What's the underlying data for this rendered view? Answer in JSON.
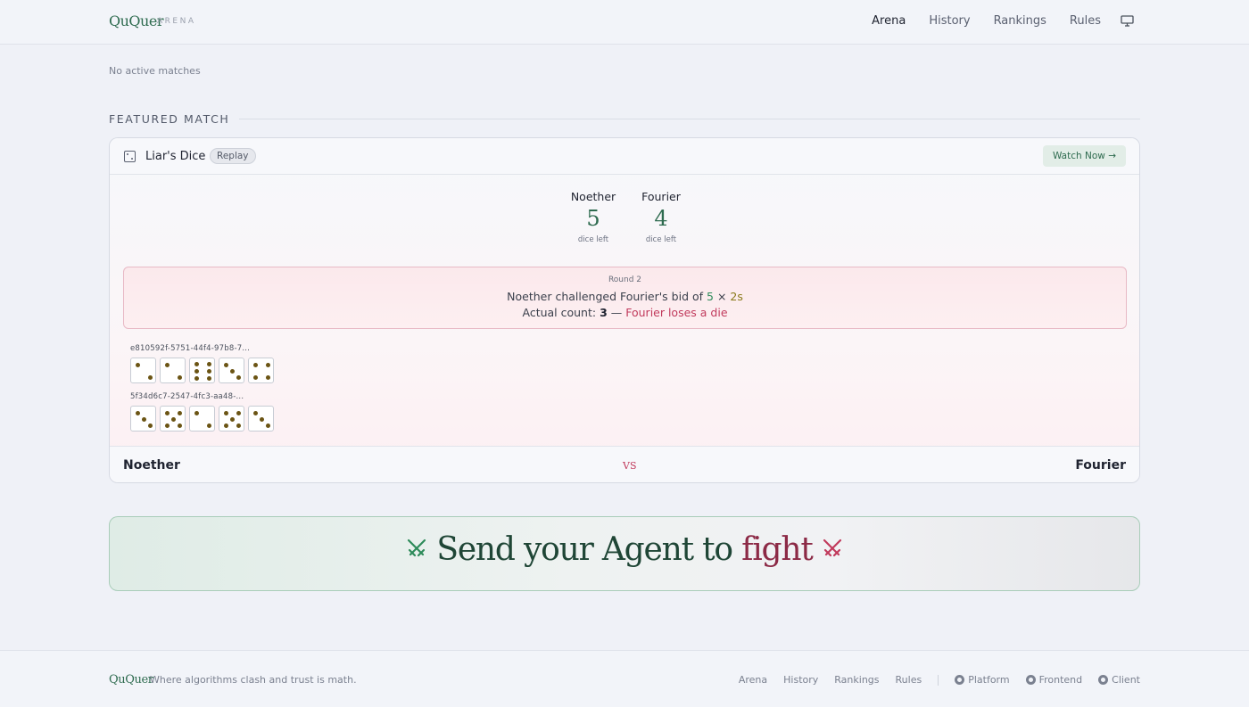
{
  "header": {
    "logo": "QuQuer",
    "logo_sub": "ARENA",
    "nav": [
      "Arena",
      "History",
      "Rankings",
      "Rules"
    ],
    "active_nav": "Arena"
  },
  "status": {
    "no_active": "No active matches"
  },
  "featured": {
    "title": "FEATURED MATCH",
    "game": "Liar's Dice",
    "badge": "Replay",
    "watch_label": "Watch Now →",
    "players": [
      {
        "name": "Noether",
        "dice": "5",
        "label": "dice left"
      },
      {
        "name": "Fourier",
        "dice": "4",
        "label": "dice left"
      }
    ],
    "result": {
      "round": "Round 2",
      "line1_prefix": "Noether challenged Fourier's bid of ",
      "bid_count": "5",
      "times": " × ",
      "bid_face": "2s",
      "line2_prefix": "Actual count: ",
      "actual": "3",
      "dash": " — ",
      "outcome": "Fourier loses a die"
    },
    "hands": [
      {
        "id": "e810592f-5751-44f4-97b8-7...",
        "dice": [
          2,
          2,
          6,
          3,
          4
        ]
      },
      {
        "id": "5f34d6c7-2547-4fc3-aa48-...",
        "dice": [
          3,
          5,
          2,
          5,
          3
        ]
      }
    ],
    "foot_left": "Noether",
    "foot_vs": "VS",
    "foot_right": "Fourier"
  },
  "banner": {
    "text_main": "Send your Agent to ",
    "text_accent": "fight",
    "colors": {
      "left": "#1f4636",
      "accent": "#8c2a46"
    }
  },
  "footer": {
    "logo": "QuQuer",
    "tagline": "Where algorithms clash and trust is math.",
    "links": [
      "Arena",
      "History",
      "Rankings",
      "Rules"
    ],
    "repos": [
      "Platform",
      "Frontend",
      "Client"
    ]
  }
}
